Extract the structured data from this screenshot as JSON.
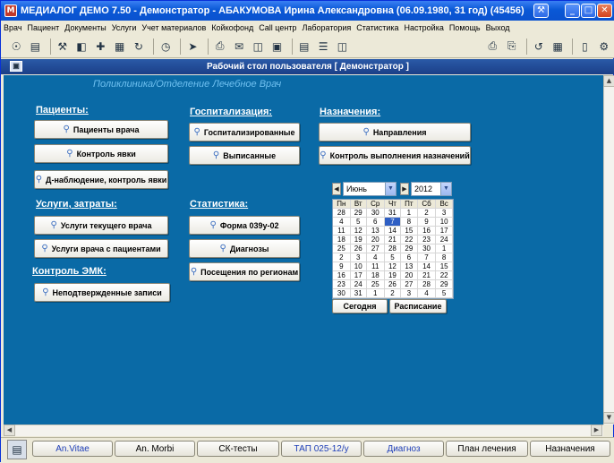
{
  "window": {
    "title": "МЕДИАЛОГ ДЕМО 7.50 - Демонстратор - АБАКУМОВА Ирина Александровна (06.09.1980, 31 год) (45456)"
  },
  "menu": [
    "Врач",
    "Пациент",
    "Документы",
    "Услуги",
    "Учет материалов",
    "Койкофонд",
    "Call центр",
    "Лаборатория",
    "Статистика",
    "Настройка",
    "Помощь",
    "Выход"
  ],
  "panel": {
    "title": "Рабочий стол пользователя  [ Демонстратор ]",
    "breadcrumb": "Поликлиника/Отделение Лечебное Врач"
  },
  "sections": {
    "patients": {
      "heading": "Пациенты:",
      "buttons": [
        "Пациенты врача",
        "Контроль явки",
        "Д-наблюдение, контроль явки"
      ]
    },
    "services": {
      "heading": "Услуги, затраты:",
      "buttons": [
        "Услуги текущего врача",
        "Услуги врача с пациентами"
      ]
    },
    "emk": {
      "heading": "Контроль ЭМК:",
      "buttons": [
        "Неподтвержденные записи"
      ]
    },
    "hospital": {
      "heading": "Госпитализация:",
      "buttons": [
        "Госпитализированные",
        "Выписанные"
      ]
    },
    "stats": {
      "heading": "Статистика:",
      "buttons": [
        "Форма 039у-02",
        "Диагнозы",
        "Посещения по регионам"
      ]
    },
    "orders": {
      "heading": "Назначения:",
      "buttons": [
        "Направления",
        "Контроль выполнения назначений"
      ]
    }
  },
  "calendar": {
    "month": "Июнь",
    "year": "2012",
    "weekdays": [
      "Пн",
      "Вт",
      "Ср",
      "Чт",
      "Пт",
      "Сб",
      "Вс"
    ],
    "weeks": [
      [
        "28",
        "29",
        "30",
        "31",
        "1",
        "2",
        "3"
      ],
      [
        "4",
        "5",
        "6",
        "7",
        "8",
        "9",
        "10"
      ],
      [
        "11",
        "12",
        "13",
        "14",
        "15",
        "16",
        "17"
      ],
      [
        "18",
        "19",
        "20",
        "21",
        "22",
        "23",
        "24"
      ],
      [
        "25",
        "26",
        "27",
        "28",
        "29",
        "30",
        "1"
      ],
      [
        "2",
        "3",
        "4",
        "5",
        "6",
        "7",
        "8"
      ],
      [
        "9",
        "10",
        "11",
        "12",
        "13",
        "14",
        "15"
      ],
      [
        "16",
        "17",
        "18",
        "19",
        "20",
        "21",
        "22"
      ],
      [
        "23",
        "24",
        "25",
        "26",
        "27",
        "28",
        "29"
      ],
      [
        "30",
        "31",
        "1",
        "2",
        "3",
        "4",
        "5"
      ]
    ],
    "selected": "7",
    "today_button": "Сегодня",
    "schedule_button": "Расписание"
  },
  "bottom_tabs": [
    "An.Vitae",
    "An. Morbi",
    "СК-тесты",
    "ТАП 025-12/у",
    "Диагноз",
    "План лечения",
    "Назначения"
  ]
}
